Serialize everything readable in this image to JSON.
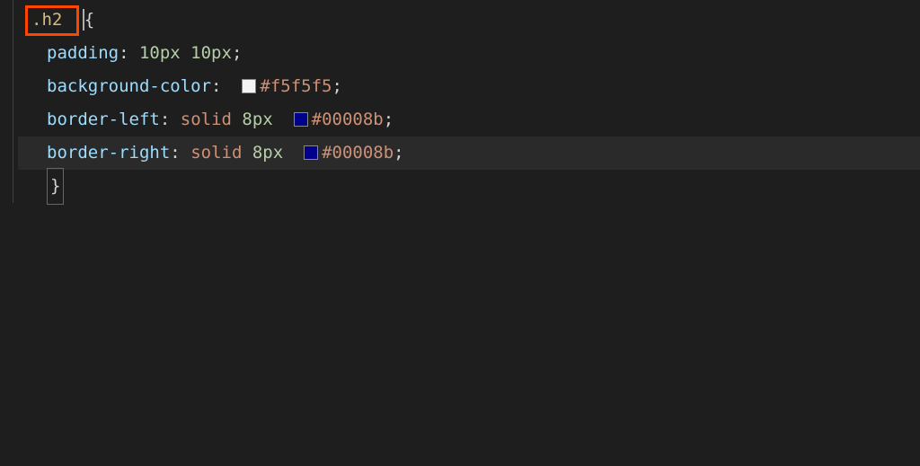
{
  "code": {
    "selector": ".h2",
    "open_brace": "{",
    "close_brace": "}",
    "props": {
      "padding": {
        "name": "padding",
        "value": "10px 10px"
      },
      "background_color": {
        "name": "background-color",
        "swatch_color": "#f5f5f5",
        "value": "#f5f5f5"
      },
      "border_left": {
        "name": "border-left",
        "keyword": "solid",
        "size": "8px",
        "swatch_color": "#00008b",
        "value": "#00008b"
      },
      "border_right": {
        "name": "border-right",
        "keyword": "solid",
        "size": "8px",
        "swatch_color": "#00008b",
        "value": "#00008b"
      }
    }
  },
  "punctuation": {
    "colon": ":",
    "semi": ";",
    "space": " "
  }
}
